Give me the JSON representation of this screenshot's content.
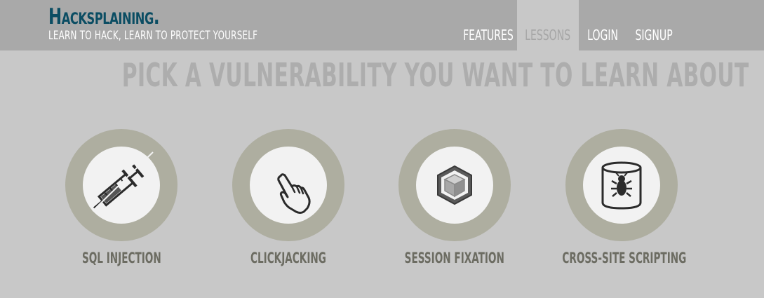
{
  "brand": {
    "name": "Hacksplaining.",
    "tagline": "Learn to hack, learn to protect yourself"
  },
  "nav": {
    "items": [
      {
        "label": "Features",
        "active": false
      },
      {
        "label": "Lessons",
        "active": true
      },
      {
        "label": "Login",
        "active": false
      },
      {
        "label": "Signup",
        "active": false
      }
    ]
  },
  "main": {
    "headline": "Pick a vulnerability you want to learn about",
    "lessons": [
      {
        "label": "SQL Injection",
        "icon": "syringe-icon"
      },
      {
        "label": "Clickjacking",
        "icon": "pointing-hand-icon"
      },
      {
        "label": "Session Fixation",
        "icon": "cube-icon"
      },
      {
        "label": "Cross-Site Scripting",
        "icon": "bug-in-database-icon"
      }
    ]
  },
  "colors": {
    "topbar": "#a9a9a9",
    "background": "#c8c8c8",
    "brand": "#0b4d63",
    "ring": "#aeaea0",
    "icon_bg": "#f2f2f2",
    "label": "#6c6c62",
    "headline": "#adadad"
  }
}
